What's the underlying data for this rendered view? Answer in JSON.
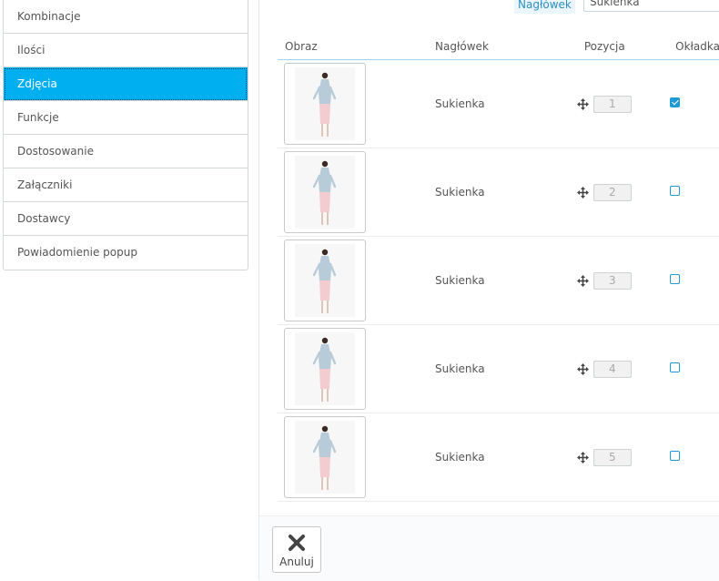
{
  "sidebar": {
    "items": [
      {
        "label": "Kombinacje",
        "active": false
      },
      {
        "label": "Ilości",
        "active": false
      },
      {
        "label": "Zdjęcia",
        "active": true
      },
      {
        "label": "Funkcje",
        "active": false
      },
      {
        "label": "Dostosowanie",
        "active": false
      },
      {
        "label": "Załączniki",
        "active": false
      },
      {
        "label": "Dostawcy",
        "active": false
      },
      {
        "label": "Powiadomienie popup",
        "active": false
      }
    ]
  },
  "legend": {
    "label": "Nagłówek",
    "value": "Sukienka"
  },
  "table": {
    "headers": {
      "image": "Obraz",
      "caption": "Nagłówek",
      "position": "Pozycja",
      "cover": "Okładka"
    },
    "rows": [
      {
        "caption": "Sukienka",
        "position": "1",
        "cover": true
      },
      {
        "caption": "Sukienka",
        "position": "2",
        "cover": false
      },
      {
        "caption": "Sukienka",
        "position": "3",
        "cover": false
      },
      {
        "caption": "Sukienka",
        "position": "4",
        "cover": false
      },
      {
        "caption": "Sukienka",
        "position": "5",
        "cover": false
      }
    ]
  },
  "footer": {
    "cancel_label": "Anuluj"
  },
  "colors": {
    "accent": "#00aff0",
    "checkbox": "#1e9ad6"
  },
  "icons": {
    "move": "move-icon",
    "cancel": "close-icon"
  }
}
